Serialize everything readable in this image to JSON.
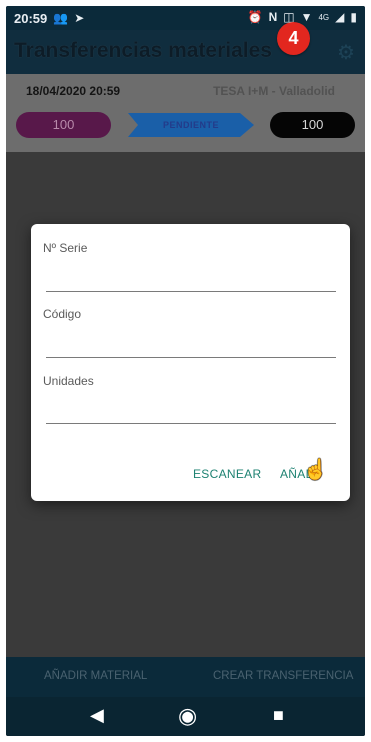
{
  "status_bar": {
    "time": "20:59",
    "left_icons": [
      "people-icon",
      "send-icon"
    ],
    "right_icons": [
      "alarm-icon",
      "nfc-icon",
      "vibrate-icon",
      "wifi-icon",
      "4g-icon",
      "signal-icon",
      "battery-icon"
    ],
    "network_label": "4G"
  },
  "app_bar": {
    "title": "Transferencias materiales",
    "settings_icon": "gear-icon",
    "step_badge": "4"
  },
  "info_panel": {
    "date": "18/04/2020 20:59",
    "location": "TESA I+M - Valladolid",
    "left_count": "100",
    "state": "PENDIENTE",
    "right_count": "100"
  },
  "dialog": {
    "serial_label": "Nº Serie",
    "code_label": "Código",
    "units_label": "Unidades",
    "scan_label": "ESCANEAR",
    "add_label": "AÑADIR"
  },
  "bottom_bar": {
    "add_material": "AÑADIR MATERIAL",
    "create_transfer": "CREAR TRANSFERENCIA"
  },
  "nav_bar": {
    "icons": [
      "back-icon",
      "home-icon",
      "recents-icon"
    ]
  },
  "colors": {
    "app_bar": "#102d3e",
    "pill_left": "#58184a",
    "pill_right": "#050505",
    "arrow": "#1a5fa8",
    "badge": "#e2271f",
    "dialog_accent": "#1e8272"
  }
}
